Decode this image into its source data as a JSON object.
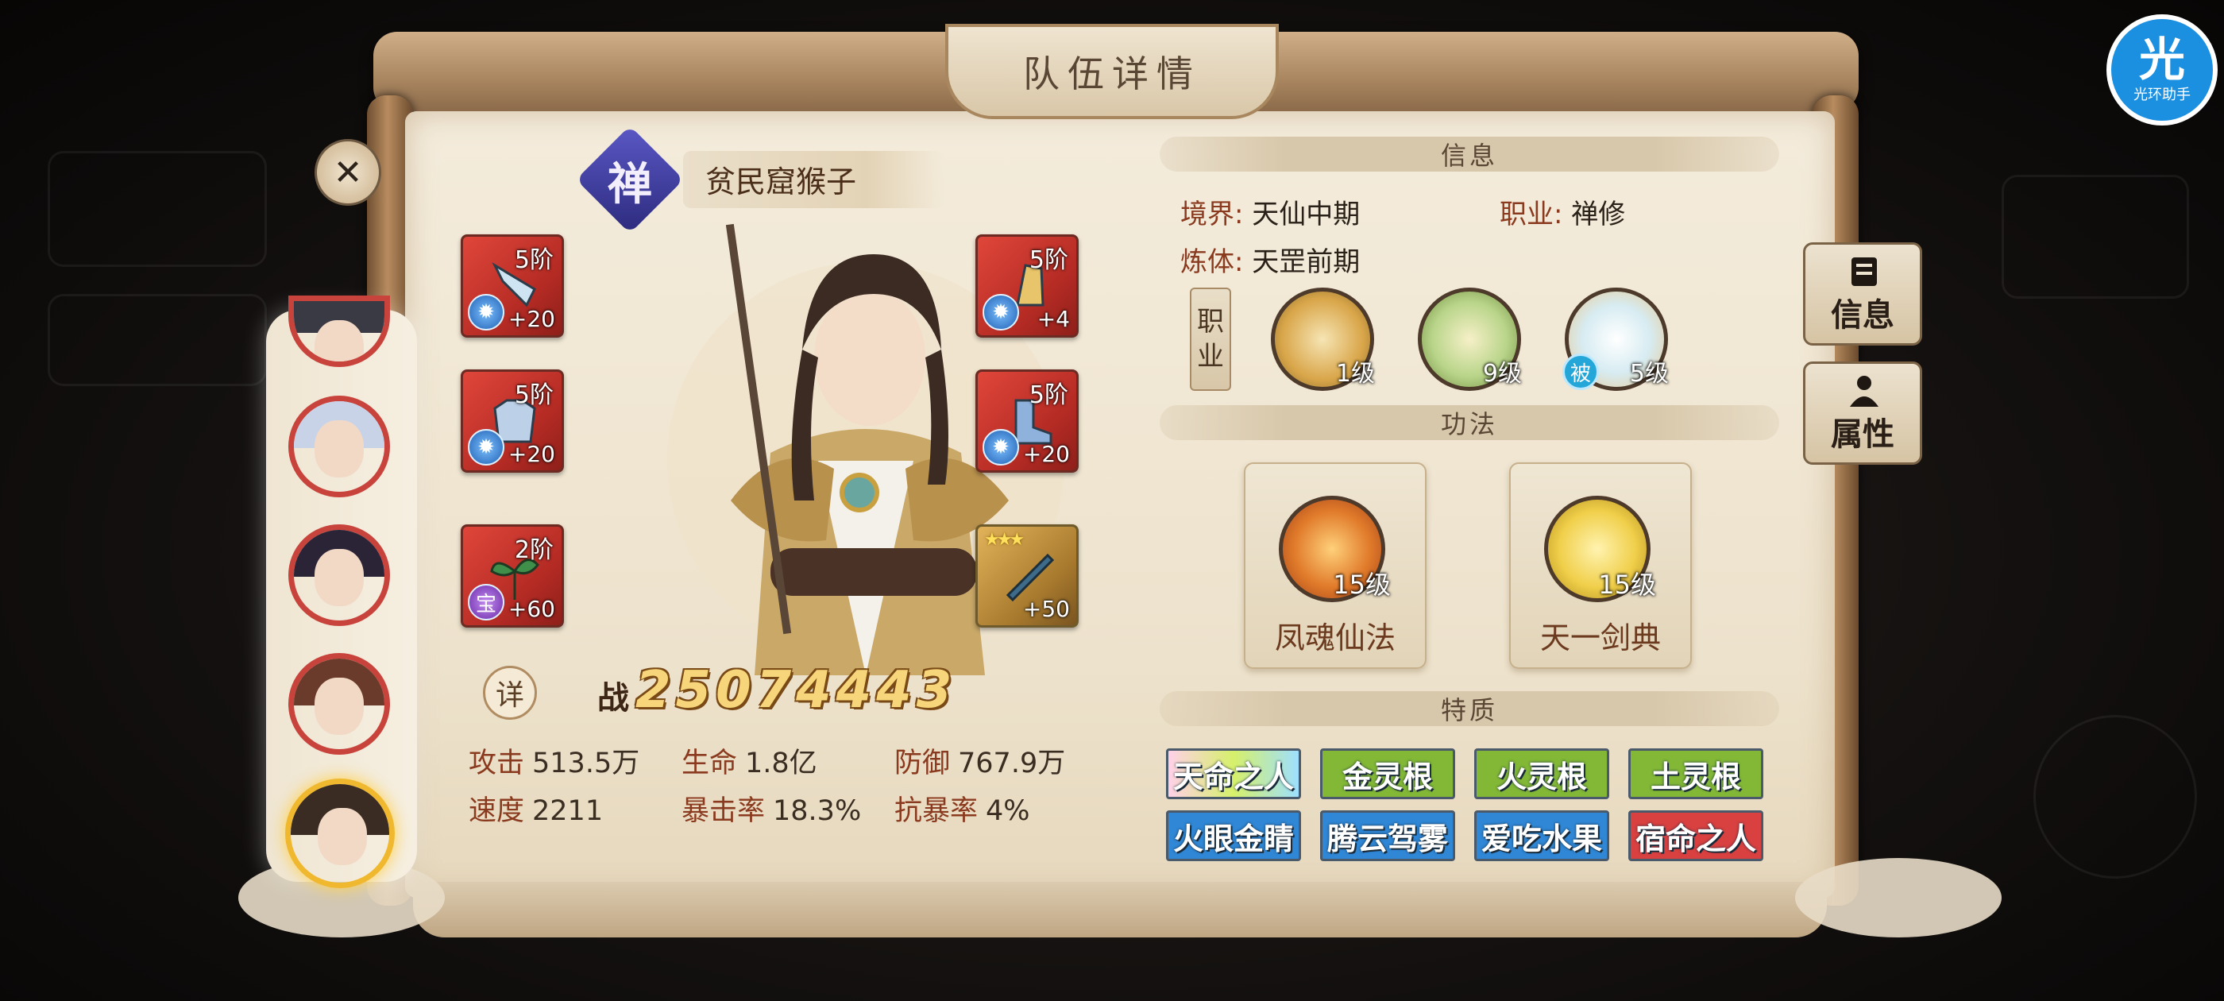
{
  "window": {
    "title": "队伍详情"
  },
  "badge": {
    "icon": "光",
    "label": "光环助手"
  },
  "hero": {
    "class_char": "禅",
    "name": "贫民窟猴子",
    "power_label": "战",
    "power_value": "25074443",
    "detail_button": "详"
  },
  "equipment": [
    {
      "tier": "5阶",
      "bonus": "+20",
      "gem": "gem-icon",
      "item": "blade-icon"
    },
    {
      "tier": "5阶",
      "bonus": "+4",
      "gem": "gem-icon",
      "item": "gauntlet-icon"
    },
    {
      "tier": "5阶",
      "bonus": "+20",
      "gem": "gem-icon",
      "item": "armor-icon"
    },
    {
      "tier": "5阶",
      "bonus": "+20",
      "gem": "gem-icon",
      "item": "boots-icon"
    },
    {
      "tier": "2阶",
      "bonus": "+60",
      "gem_label": "宝",
      "item": "herb-icon"
    },
    {
      "stars": "★★★",
      "bonus": "+50",
      "item": "sword-icon"
    }
  ],
  "stats": [
    {
      "label": "攻击",
      "value": "513.5万"
    },
    {
      "label": "生命",
      "value": "1.8亿"
    },
    {
      "label": "防御",
      "value": "767.9万"
    },
    {
      "label": "速度",
      "value": "2211"
    },
    {
      "label": "暴击率",
      "value": "18.3%"
    },
    {
      "label": "抗暴率",
      "value": "4%"
    }
  ],
  "info": {
    "section": "信息",
    "realm_label": "境界:",
    "realm_value": "天仙中期",
    "job_label": "职业:",
    "job_value": "禅修",
    "body_label": "炼体:",
    "body_value": "天罡前期",
    "job_tab_1": "职",
    "job_tab_2": "业",
    "skills": [
      {
        "level": "1级"
      },
      {
        "level": "9级"
      },
      {
        "level": "5级",
        "passive": "被"
      }
    ]
  },
  "gongfa": {
    "section": "功法",
    "items": [
      {
        "name": "凤魂仙法",
        "level": "15级"
      },
      {
        "name": "天一剑典",
        "level": "15级"
      }
    ]
  },
  "traits": {
    "section": "特质",
    "items": [
      {
        "name": "天命之人",
        "color": "#d6f06a"
      },
      {
        "name": "金灵根",
        "color": "#82b836"
      },
      {
        "name": "火灵根",
        "color": "#82b836"
      },
      {
        "name": "土灵根",
        "color": "#82b836"
      },
      {
        "name": "火眼金睛",
        "color": "#2f87d6"
      },
      {
        "name": "腾云驾雾",
        "color": "#2f87d6"
      },
      {
        "name": "爱吃水果",
        "color": "#2f87d6"
      },
      {
        "name": "宿命之人",
        "color": "#d94040"
      }
    ]
  },
  "side_tabs": [
    {
      "label": "信息"
    },
    {
      "label": "属性"
    }
  ],
  "colors": {
    "accent_red": "#c8433c",
    "selected_gold": "#f0b82e",
    "paper": "#f4ecdc"
  }
}
